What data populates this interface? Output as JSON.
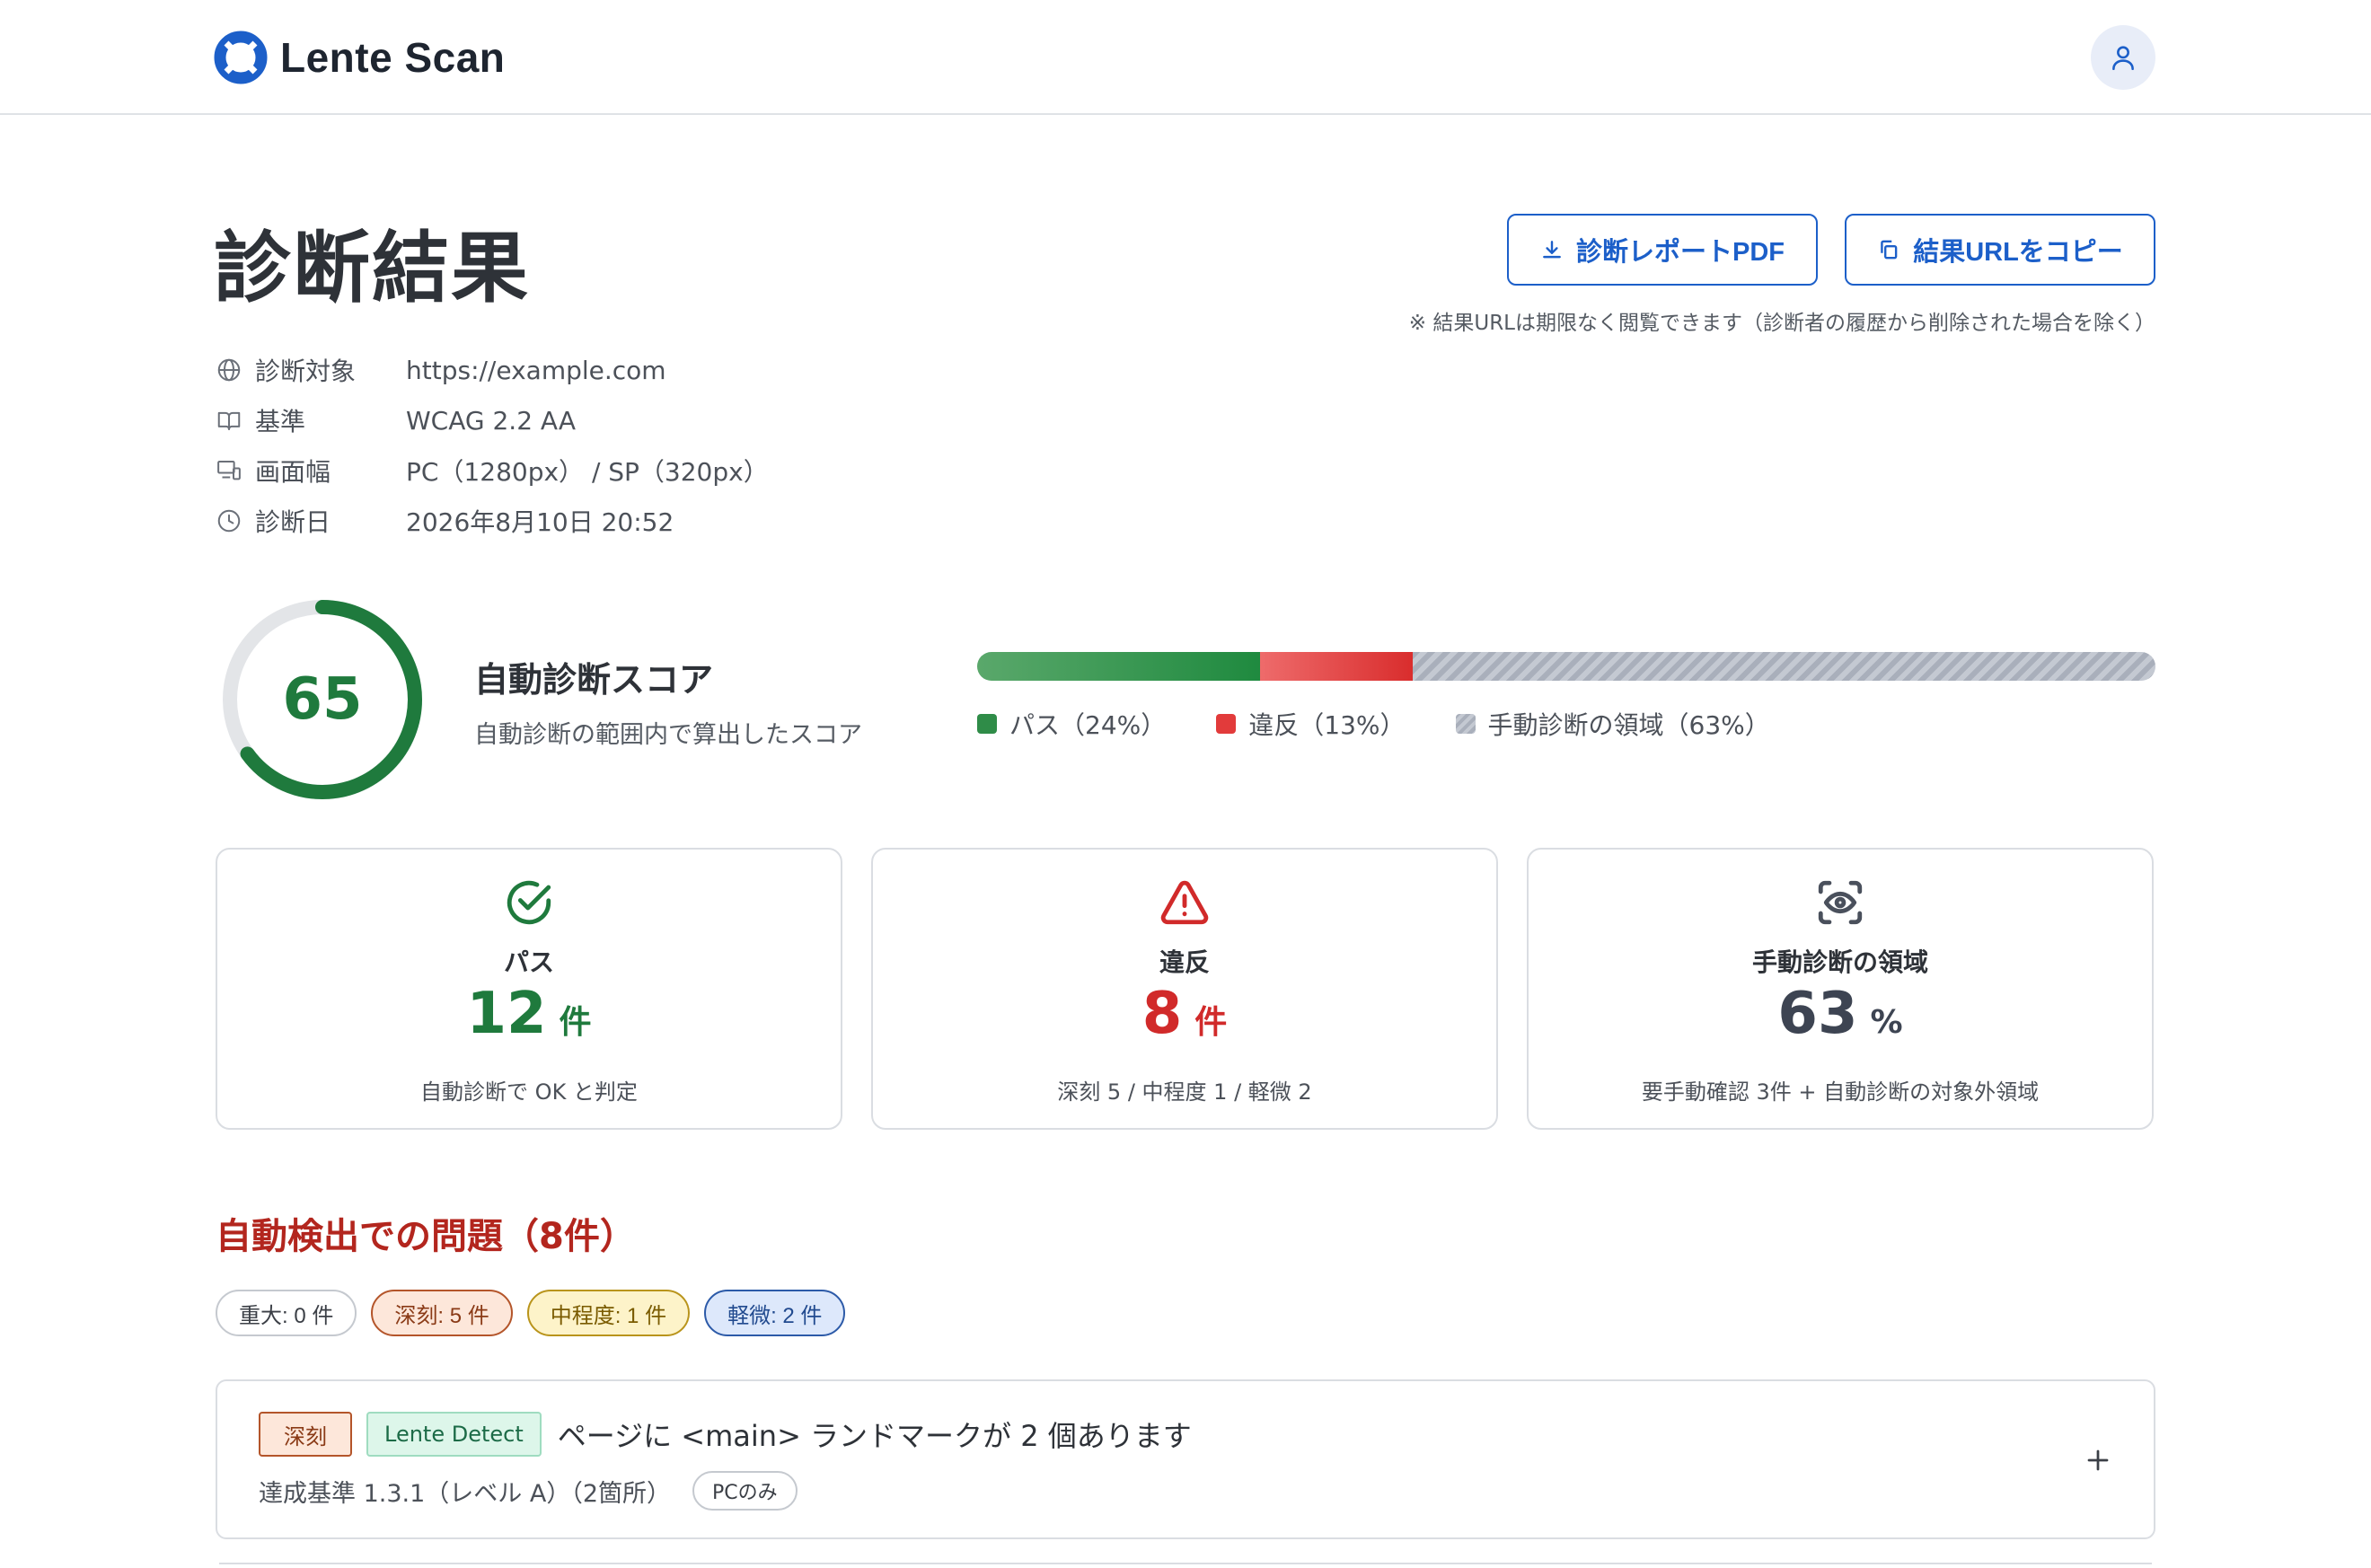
{
  "header": {
    "app_name": "Lente Scan",
    "logo_icon": "lifebuoy-icon",
    "user_icon": "user-icon",
    "brand_color": "#1c5fc9"
  },
  "page": {
    "title": "診断結果",
    "actions": {
      "pdf_label": "診断レポートPDF",
      "copy_label": "結果URLをコピー"
    },
    "note": "※ 結果URLは期限なく閲覧できます（診断者の履歴から削除された場合を除く）"
  },
  "meta": [
    {
      "icon": "globe-icon",
      "label": "診断対象",
      "value": "https://example.com"
    },
    {
      "icon": "book-icon",
      "label": "基準",
      "value": "WCAG 2.2 AA"
    },
    {
      "icon": "devices-icon",
      "label": "画面幅",
      "value": "PC（1280px） / SP（320px）"
    },
    {
      "icon": "clock-icon",
      "label": "診断日",
      "value": "2026年8月10日 20:52"
    }
  ],
  "score": {
    "value": "65",
    "fraction": 0.65,
    "title": "自動診断スコア",
    "subtitle": "自動診断の範囲内で算出したスコア"
  },
  "distribution": {
    "pass_pct": 24,
    "fail_pct": 13,
    "manual_pct": 63,
    "legend": {
      "pass": "パス（24%）",
      "fail": "違反（13%）",
      "manual": "手動診断の領域（63%）"
    },
    "colors": {
      "pass": "#2f8c48",
      "fail": "#e23b3b",
      "manual": "#a9afbb"
    }
  },
  "cards": {
    "pass": {
      "label": "パス",
      "num": "12",
      "unit": "件",
      "desc": "自動診断で OK と判定"
    },
    "fail": {
      "label": "違反",
      "num": "8",
      "unit": "件",
      "desc": "深刻 5 / 中程度 1 / 軽微 2"
    },
    "manual": {
      "label": "手動診断の領域",
      "num": "63",
      "unit": "%",
      "desc": "要手動確認 3件 + 自動診断の対象外領域"
    }
  },
  "issues": {
    "title": "自動検出での問題（8件）",
    "filters": {
      "critical": "重大: 0 件",
      "serious": "深刻: 5 件",
      "moderate": "中程度: 1 件",
      "minor": "軽微: 2 件"
    },
    "items": [
      {
        "severity": "深刻",
        "source": "Lente Detect",
        "title": "ページに <main> ランドマークが 2 個あります",
        "criterion": "達成基準 1.3.1（レベル A）",
        "count": "（2箇所）",
        "scope": "PCのみ"
      }
    ]
  }
}
